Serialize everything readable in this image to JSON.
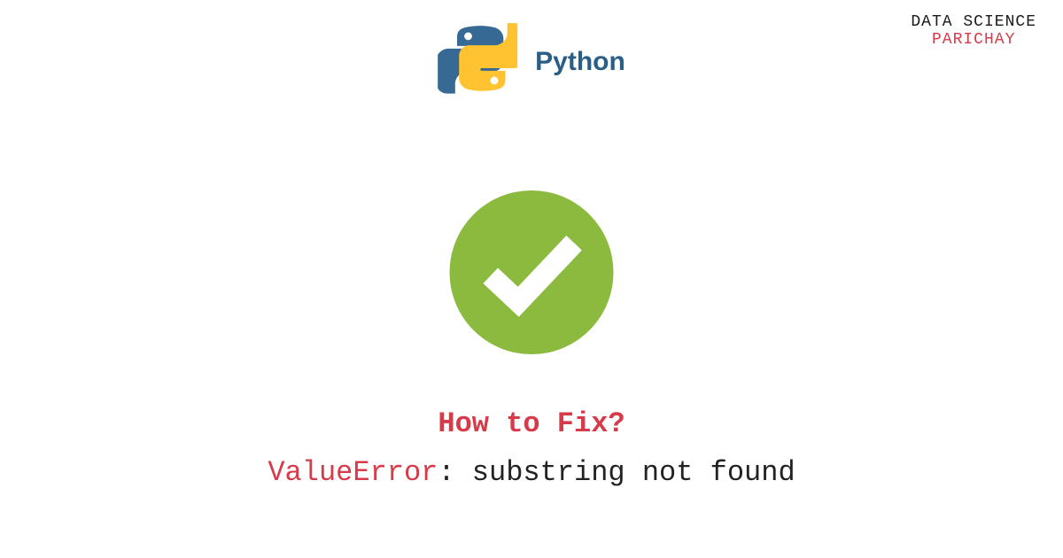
{
  "header": {
    "python_label": "Python"
  },
  "brand": {
    "line1": "DATA SCIENCE",
    "line2": "PARICHAY"
  },
  "content": {
    "how_to_fix": "How to Fix?",
    "error_type": "ValueError",
    "error_separator": ": ",
    "error_message": "substring not found"
  },
  "colors": {
    "accent_red": "#D73A49",
    "python_blue": "#366994",
    "python_yellow": "#FFC331",
    "check_green": "#8BBA3F"
  }
}
